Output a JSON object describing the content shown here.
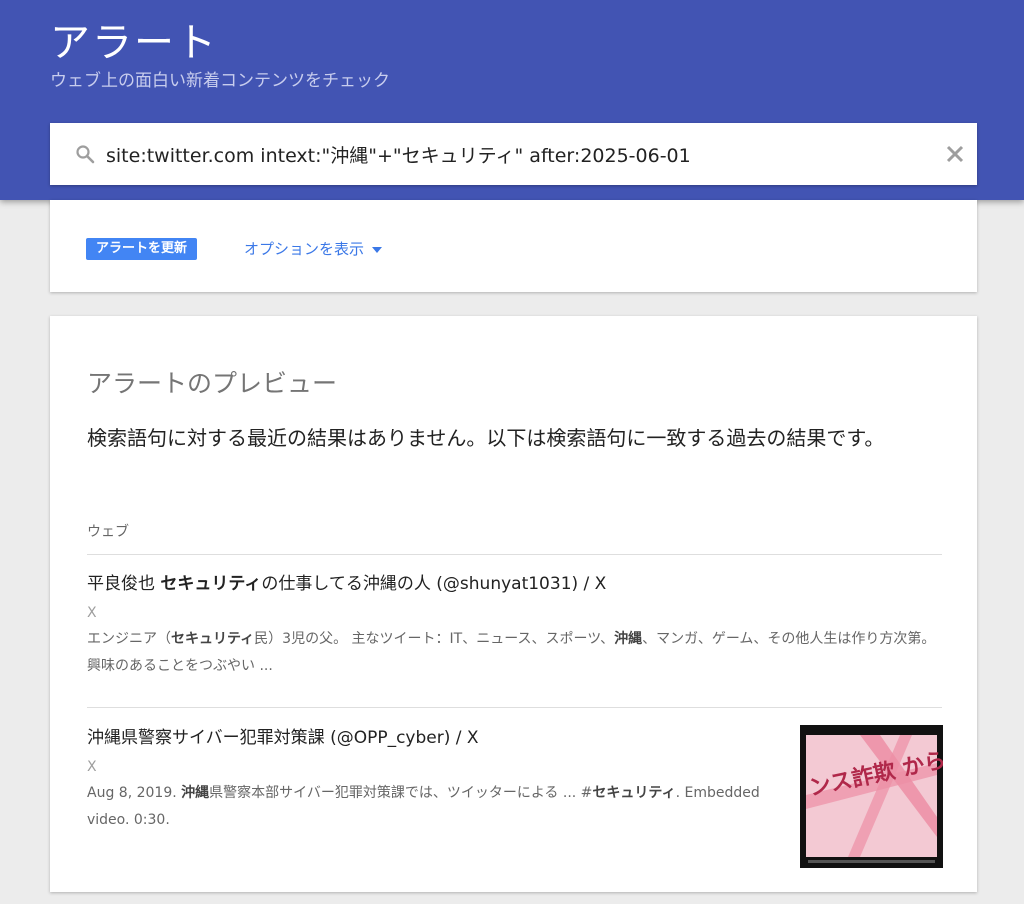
{
  "header": {
    "title": "アラート",
    "subtitle": "ウェブ上の面白い新着コンテンツをチェック"
  },
  "search": {
    "query": "site:twitter.com intext:\"沖縄\"+\"セキュリティ\" after:2025-06-01"
  },
  "options": {
    "update_button": "アラートを更新",
    "show_options": "オプションを表示"
  },
  "preview": {
    "title": "アラートのプレビュー",
    "message": "検索語句に対する最近の結果はありません。以下は検索語句に一致する過去の結果です。",
    "section_label": "ウェブ",
    "results": [
      {
        "title_pre": "平良俊也 ",
        "title_bold": "セキュリティ",
        "title_post": "の仕事してる沖縄の人 (@shunyat1031) / X",
        "source": "X",
        "snippet_1": "エンジニア（",
        "snippet_bold_1": "セキュリティ",
        "snippet_2": "民）3児の父。 主なツイート：IT、ニュース、スポーツ、",
        "snippet_bold_2": "沖縄",
        "snippet_3": "、マンガ、ゲーム、その他人生は作り方次第。 興味のあることをつぶやい ..."
      },
      {
        "title": "沖縄県警察サイバー犯罪対策課 (@OPP_cyber) / X",
        "source": "X",
        "snippet_1": "Aug 8, 2019. ",
        "snippet_bold_1": "沖縄",
        "snippet_2": "県警察本部サイバー犯罪対策課では、ツイッターによる ... #",
        "snippet_bold_2": "セキュリティ",
        "snippet_3": ". Embedded video. 0:30.",
        "thumbnail_text": "ンス詐欺 から守る"
      }
    ]
  },
  "colors": {
    "header_bg": "#4254b3",
    "button_bg": "#4285f4",
    "link": "#3b78e7"
  }
}
